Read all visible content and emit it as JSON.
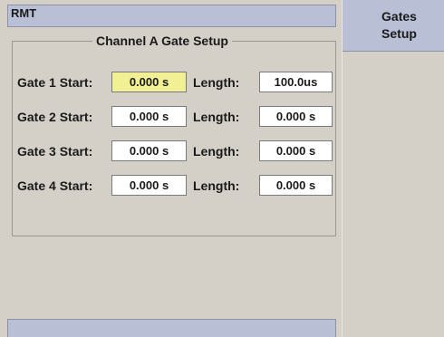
{
  "status": {
    "remote": "RMT"
  },
  "softkey": {
    "line1": "Gates",
    "line2": "Setup"
  },
  "panel": {
    "title": "Channel A Gate Setup",
    "length_label": "Length:",
    "gates": [
      {
        "label": "Gate 1 Start:",
        "start": "0.000 s",
        "length": "100.0us",
        "selected": true
      },
      {
        "label": "Gate 2 Start:",
        "start": "0.000 s",
        "length": "0.000 s",
        "selected": false
      },
      {
        "label": "Gate 3 Start:",
        "start": "0.000 s",
        "length": "0.000 s",
        "selected": false
      },
      {
        "label": "Gate 4 Start:",
        "start": "0.000 s",
        "length": "0.000 s",
        "selected": false
      }
    ]
  }
}
